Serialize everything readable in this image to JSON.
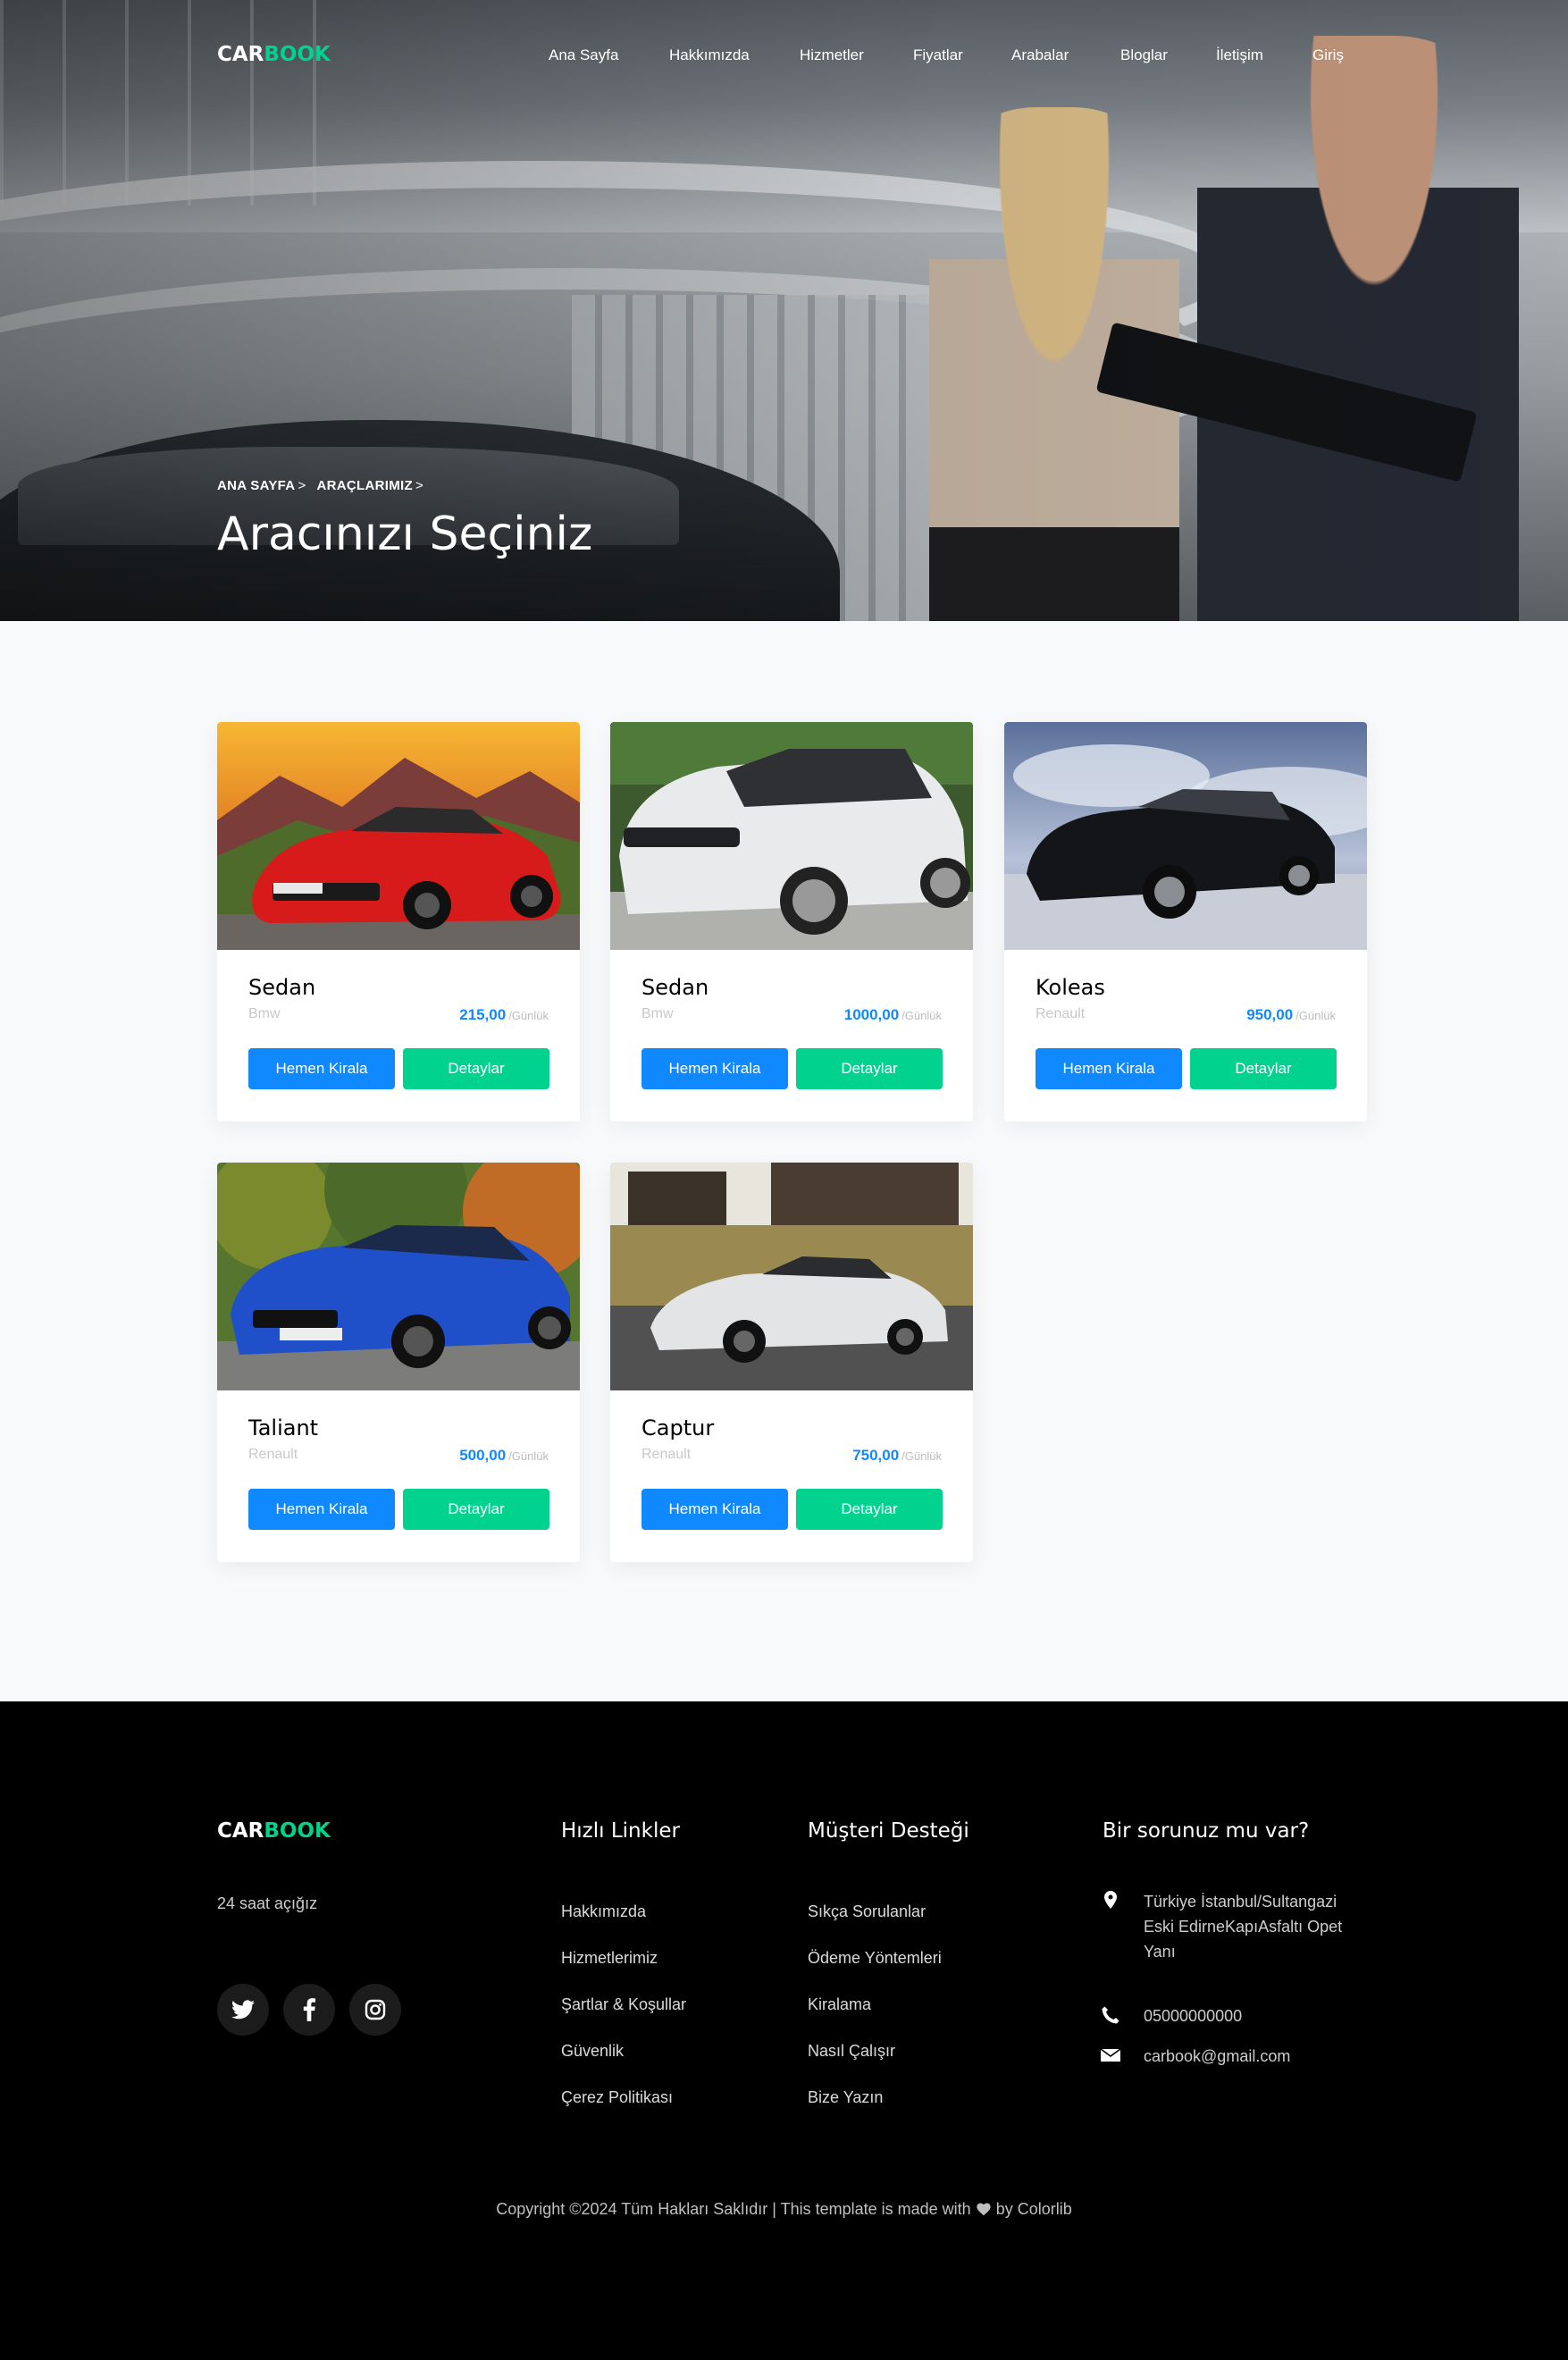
{
  "brand": {
    "part1": "CAR",
    "part2": "BOOK"
  },
  "nav": {
    "items": [
      "Ana Sayfa",
      "Hakkımızda",
      "Hizmetler",
      "Fiyatlar",
      "Arabalar",
      "Bloglar",
      "İletişim",
      "Giriş"
    ]
  },
  "hero": {
    "breadcrumb": [
      "ANA SAYFA",
      "ARAÇLARIMIZ"
    ],
    "breadcrumb_sep": ">",
    "title": "Aracınızı Seçiniz"
  },
  "cars": [
    {
      "title": "Sedan",
      "category": "Bmw",
      "price": "215,00",
      "unit": "/Günlük",
      "rent_label": "Hemen Kirala",
      "detail_label": "Detaylar"
    },
    {
      "title": "Sedan",
      "category": "Bmw",
      "price": "1000,00",
      "unit": "/Günlük",
      "rent_label": "Hemen Kirala",
      "detail_label": "Detaylar"
    },
    {
      "title": "Koleas",
      "category": "Renault",
      "price": "950,00",
      "unit": "/Günlük",
      "rent_label": "Hemen Kirala",
      "detail_label": "Detaylar"
    },
    {
      "title": "Taliant",
      "category": "Renault",
      "price": "500,00",
      "unit": "/Günlük",
      "rent_label": "Hemen Kirala",
      "detail_label": "Detaylar"
    },
    {
      "title": "Captur",
      "category": "Renault",
      "price": "750,00",
      "unit": "/Günlük",
      "rent_label": "Hemen Kirala",
      "detail_label": "Detaylar"
    }
  ],
  "footer": {
    "brand": {
      "part1": "CAR",
      "part2": "BOOK"
    },
    "open_text": "24 saat açığız",
    "social": [
      "twitter-icon",
      "facebook-icon",
      "instagram-icon"
    ],
    "quick_links": {
      "heading": "Hızlı Linkler",
      "items": [
        "Hakkımızda",
        "Hizmetlerimiz",
        "Şartlar & Koşullar",
        "Güvenlik",
        "Çerez Politikası"
      ]
    },
    "support": {
      "heading": "Müşteri Desteği",
      "items": [
        "Sıkça Sorulanlar",
        "Ödeme Yöntemleri",
        "Kiralama",
        "Nasıl Çalışır",
        "Bize Yazın"
      ]
    },
    "contact": {
      "heading": "Bir sorunuz mu var?",
      "address": "Türkiye İstanbul/Sultangazi Eski EdirneKapıAsfaltı Opet Yanı",
      "phone": "05000000000",
      "email": "carbook@gmail.com"
    },
    "copyright_left": "Copyright ©2024 Tüm Hakları Saklıdır | This template is made with",
    "copyright_right": "by Colorlib"
  },
  "colors": {
    "accent_green": "#01d28e",
    "accent_blue": "#1089ff",
    "footer_bg": "#000000"
  }
}
